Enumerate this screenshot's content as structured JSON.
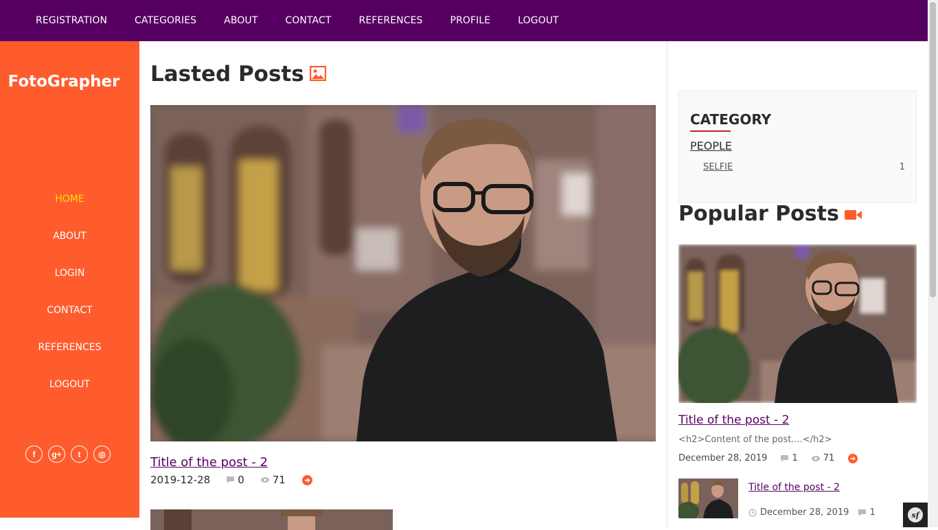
{
  "topnav": {
    "items": [
      {
        "label": "REGISTRATION"
      },
      {
        "label": "CATEGORIES"
      },
      {
        "label": "ABOUT"
      },
      {
        "label": "CONTACT"
      },
      {
        "label": "REFERENCES"
      },
      {
        "label": "PROFILE"
      },
      {
        "label": "LOGOUT"
      }
    ]
  },
  "sidebar": {
    "brand": "FotoGrapher",
    "items": [
      {
        "label": "HOME",
        "active": true
      },
      {
        "label": "ABOUT"
      },
      {
        "label": "LOGIN"
      },
      {
        "label": "CONTACT"
      },
      {
        "label": "REFERENCES"
      },
      {
        "label": "LOGOUT"
      }
    ],
    "social": [
      {
        "icon": "facebook-icon",
        "glyph": "f"
      },
      {
        "icon": "google-plus-icon",
        "glyph": "g+"
      },
      {
        "icon": "twitter-icon",
        "glyph": "t"
      },
      {
        "icon": "dribbble-icon",
        "glyph": "◎"
      }
    ]
  },
  "main": {
    "title": "Lasted Posts",
    "title_icon": "image-icon",
    "post": {
      "title": "Title of the post - 2",
      "date": "2019-12-28",
      "comments": "0",
      "views": "71"
    }
  },
  "category": {
    "heading": "CATEGORY",
    "parent": "PEOPLE",
    "child": "SELFIE",
    "count": "1"
  },
  "popular": {
    "title": "Popular Posts",
    "title_icon": "video-camera-icon",
    "post": {
      "title": "Title of the post - 2",
      "excerpt": "<h2>Content of the post....</h2>",
      "date": "December 28, 2019",
      "comments": "1",
      "views": "71"
    },
    "small_post": {
      "title": "Title of the post - 2",
      "date": "December 28, 2019",
      "comments": "1"
    }
  },
  "colors": {
    "topnav_bg": "#550060",
    "sidebar_bg": "#ff5c2e",
    "active_nav": "#ffe100",
    "link_purple": "#550060",
    "accent_orange": "#ff5c2e"
  }
}
